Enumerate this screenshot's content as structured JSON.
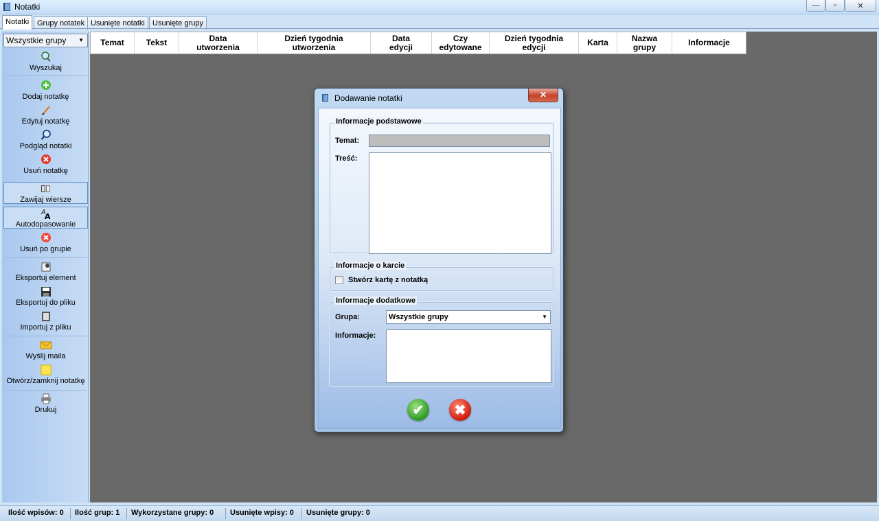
{
  "window": {
    "title": "Notatki",
    "min_glyph": "—",
    "max_glyph": "▫",
    "close_glyph": "✕"
  },
  "tabs": [
    {
      "label": "Notatki"
    },
    {
      "label": "Grupy notatek"
    },
    {
      "label": "Usunięte notatki"
    },
    {
      "label": "Usunięte grupy"
    }
  ],
  "sidebar": {
    "group_filter": "Wszystkie grupy",
    "items": [
      {
        "label": "Wyszukaj",
        "icon": "search-icon"
      },
      {
        "label": "Dodaj notatkę",
        "icon": "add-icon"
      },
      {
        "label": "Edytuj notatkę",
        "icon": "pencil-icon"
      },
      {
        "label": "Podgląd notatki",
        "icon": "magnifier-icon"
      },
      {
        "label": "Usuń notatkę",
        "icon": "delete-icon"
      },
      {
        "label": "Zawijaj wiersze",
        "icon": "wrap-icon"
      },
      {
        "label": "Autodopasowanie",
        "icon": "autofit-icon"
      },
      {
        "label": "Usuń po grupie",
        "icon": "delete-group-icon"
      },
      {
        "label": "Eksportuj element",
        "icon": "export-element-icon"
      },
      {
        "label": "Eksportuj do pliku",
        "icon": "save-disk-icon"
      },
      {
        "label": "Importuj z pliku",
        "icon": "import-icon"
      },
      {
        "label": "Wyślij maila",
        "icon": "mail-icon"
      },
      {
        "label": "Otwórz/zamknij notatkę",
        "icon": "note-icon"
      },
      {
        "label": "Drukuj",
        "icon": "printer-icon"
      }
    ]
  },
  "grid": {
    "columns": [
      "Temat",
      "Tekst",
      "Data\nutworzenia",
      "Dzień tygodnia\nutworzenia",
      "Data\nedycji",
      "Czy\nedytowane",
      "Dzień tygodnia\nedycji",
      "Karta",
      "Nazwa\ngrupy",
      "Informacje"
    ]
  },
  "dialog": {
    "title": "Dodawanie notatki",
    "close_glyph": "✕",
    "basic_section": "Informacje podstawowe",
    "topic_label": "Temat:",
    "topic_value": "",
    "content_label": "Treść:",
    "content_value": "",
    "card_section": "Informacje o karcie",
    "card_checkbox_label": "Stwórz kartę z notatką",
    "card_checkbox_checked": false,
    "extra_section": "Informacje dodatkowe",
    "group_label": "Grupa:",
    "group_value": "Wszystkie grupy",
    "info_label": "Informacje:",
    "info_value": "",
    "ok_glyph": "✔",
    "cancel_glyph": "✖"
  },
  "statusbar": [
    "Ilość wpisów: 0",
    "Ilość grup: 1",
    "Wykorzystane grupy: 0",
    "Usunięte wpisy: 0",
    "Usunięte grupy: 0"
  ],
  "colors": {
    "accent": "#5b93c9",
    "workspace_bg": "#696969",
    "ok_green": "#2e9a26",
    "cancel_red": "#d11a0b"
  }
}
